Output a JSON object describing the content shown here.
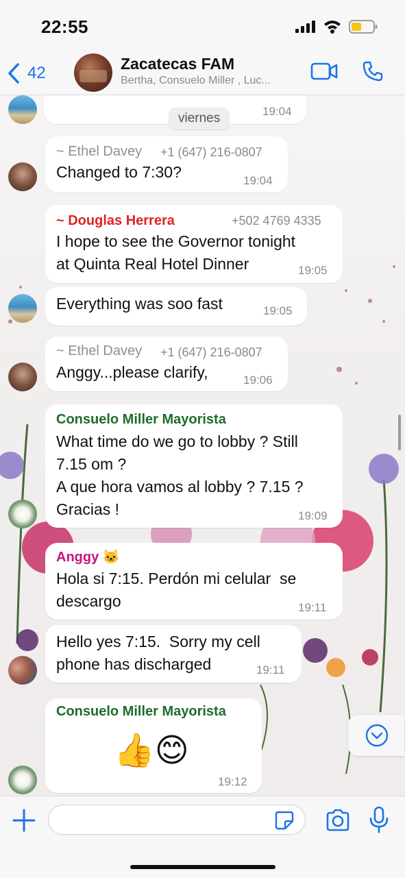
{
  "status_bar": {
    "time": "22:55"
  },
  "header": {
    "back_count": "42",
    "title": "Zacatecas FAM",
    "members": "Bertha, Consuelo Miller , Luc..."
  },
  "day_chip": "viernes",
  "messages": [
    {
      "text": "",
      "time": "19:04"
    },
    {
      "sender": "~ Ethel Davey",
      "phone": "+1 (647) 216-0807",
      "text": "Changed to 7:30?",
      "time": "19:04",
      "sender_color": "#8a8f99"
    },
    {
      "sender": "~ Douglas Herrera",
      "phone": "+502 4769 4335",
      "text": "I hope to see the Governor tonight\nat Quinta Real Hotel Dinner",
      "time": "19:05",
      "sender_color": "#e02424"
    },
    {
      "text": "Everything was soo fast",
      "time": "19:05"
    },
    {
      "sender": "~ Ethel Davey",
      "phone": "+1 (647) 216-0807",
      "text": "Anggy...please clarify,",
      "time": "19:06",
      "sender_color": "#8a8f99"
    },
    {
      "sender": "Consuelo Miller  Mayorista",
      "text": "What time do we go to lobby ? Still\n7.15 om ?\nA que hora vamos al lobby ? 7.15 ?\nGracias !",
      "time": "19:09",
      "sender_color": "#1f6b2d"
    },
    {
      "sender": "Anggy 🐱",
      "text": "Hola si 7:15. Perdón mi celular  se\ndescargo",
      "time": "19:11",
      "sender_color": "#c2187a"
    },
    {
      "text": "Hello yes 7:15.  Sorry my cell\nphone has discharged",
      "time": "19:11"
    },
    {
      "sender": "Consuelo Miller  Mayorista",
      "text": "👍😊",
      "time": "19:12",
      "sender_color": "#1f6b2d"
    }
  ],
  "icons": {
    "back": "chevron-left-icon",
    "video": "video-camera-icon",
    "phone": "phone-icon",
    "plus": "plus-icon",
    "sticker": "sticker-icon",
    "camera": "camera-icon",
    "mic": "microphone-icon",
    "scroll": "chevron-down-circle-icon"
  },
  "colors": {
    "accent": "#1a73e8",
    "bubble": "#ffffff"
  },
  "input": {
    "placeholder": ""
  }
}
